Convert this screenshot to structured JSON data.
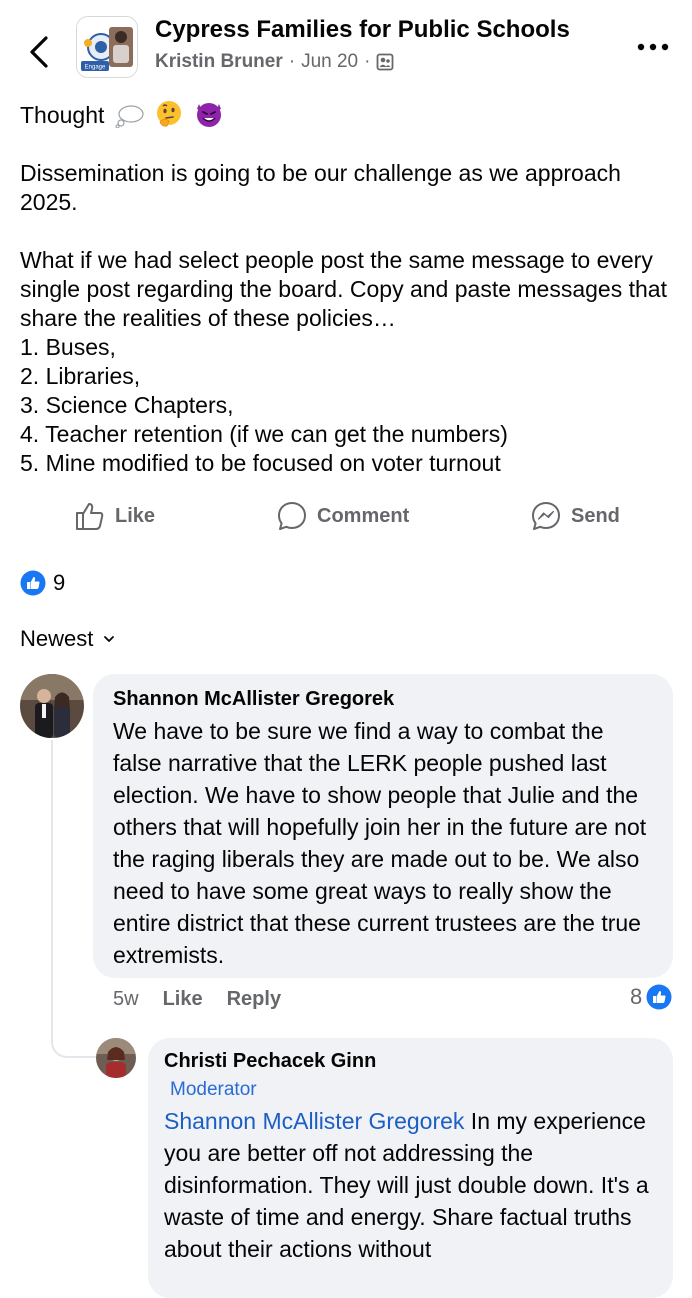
{
  "header": {
    "group_name": "Cypress Families for Public Schools",
    "author": "Kristin Bruner",
    "separator": "·",
    "date": "Jun 20",
    "avatar_badge_text": "Engage"
  },
  "post": {
    "intro": "Thought",
    "paragraph1": "Dissemination is going to be our challenge as we approach 2025.",
    "paragraph2": "What if we had select people post the same message to every single post regarding the board. Copy and paste messages that share the realities of these policies…",
    "list": [
      "1. Buses,",
      "2. Libraries,",
      "3. Science Chapters,",
      "4. Teacher retention (if we can get the numbers)",
      "5. Mine modified to be focused on voter turnout"
    ]
  },
  "actions": {
    "like": "Like",
    "comment": "Comment",
    "send": "Send"
  },
  "reactions": {
    "count": "9"
  },
  "sort": {
    "label": "Newest"
  },
  "comments": [
    {
      "author": "Shannon McAllister Gregorek",
      "text": "We have to be sure we find a way to combat the false narrative that the LERK people pushed last election. We have to show people that Julie and the others that will hopefully join her in the future are not the raging liberals they are made out to be. We also need to have some great ways to really show the entire district that these current trustees are the true extremists.",
      "time": "5w",
      "like_label": "Like",
      "reply_label": "Reply",
      "like_count": "8"
    }
  ],
  "reply": {
    "author": "Christi Pechacek Ginn",
    "badge": "Moderator",
    "mention": "Shannon McAllister Gregorek",
    "text": " In my experience you are better off not addressing the disinformation. They will just double down. It's a waste of time and energy. Share factual truths about their actions without"
  },
  "colors": {
    "facebook_blue": "#1877f2",
    "link_blue": "#1c5fc4",
    "bubble_bg": "#f0f2f5",
    "secondary_text": "#65676b"
  },
  "icons": [
    "back-chevron-icon",
    "group-globe-icon",
    "more-icon",
    "thought-bubble-icon",
    "thinking-face-icon",
    "smiling-devil-icon",
    "like-thumb-icon",
    "comment-bubble-icon",
    "messenger-send-icon",
    "like-reaction-icon",
    "chevron-down-icon"
  ]
}
